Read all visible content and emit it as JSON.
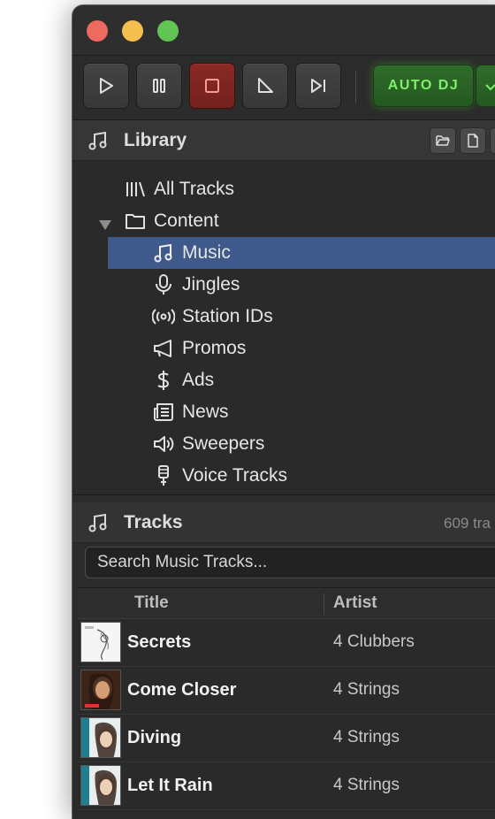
{
  "toolbar": {
    "buttons": [
      {
        "name": "play",
        "icon": "play-icon"
      },
      {
        "name": "pause",
        "icon": "pause-icon"
      },
      {
        "name": "stop",
        "icon": "stop-icon"
      },
      {
        "name": "fade",
        "icon": "fade-icon"
      },
      {
        "name": "skip",
        "icon": "skip-next-icon"
      }
    ],
    "auto_dj_label": "AUTO DJ"
  },
  "library": {
    "title": "Library",
    "items": [
      {
        "label": "All Tracks",
        "icon": "library-icon"
      },
      {
        "label": "Content",
        "icon": "folder-icon",
        "expanded": true
      },
      {
        "label": "Music",
        "icon": "music-note-icon",
        "selected": true
      },
      {
        "label": "Jingles",
        "icon": "microphone-icon"
      },
      {
        "label": "Station IDs",
        "icon": "broadcast-icon"
      },
      {
        "label": "Promos",
        "icon": "megaphone-icon"
      },
      {
        "label": "Ads",
        "icon": "dollar-icon"
      },
      {
        "label": "News",
        "icon": "newspaper-icon"
      },
      {
        "label": "Sweepers",
        "icon": "speaker-icon"
      },
      {
        "label": "Voice Tracks",
        "icon": "voice-mic-icon"
      }
    ]
  },
  "tracks": {
    "title": "Tracks",
    "count_text": "609 tra",
    "search_placeholder": "Search Music Tracks...",
    "columns": [
      "Title",
      "Artist"
    ],
    "rows": [
      {
        "title": "Secrets",
        "artist": "4 Clubbers"
      },
      {
        "title": "Come Closer",
        "artist": "4 Strings"
      },
      {
        "title": "Diving",
        "artist": "4 Strings"
      },
      {
        "title": "Let It Rain",
        "artist": "4 Strings"
      }
    ]
  },
  "colors": {
    "window_bg": "#2b2b2b",
    "selection": "#3f5a8a",
    "auto_dj_green": "#2f6c2b",
    "auto_dj_text": "#7df06a",
    "stop_red": "#8a2a26"
  }
}
